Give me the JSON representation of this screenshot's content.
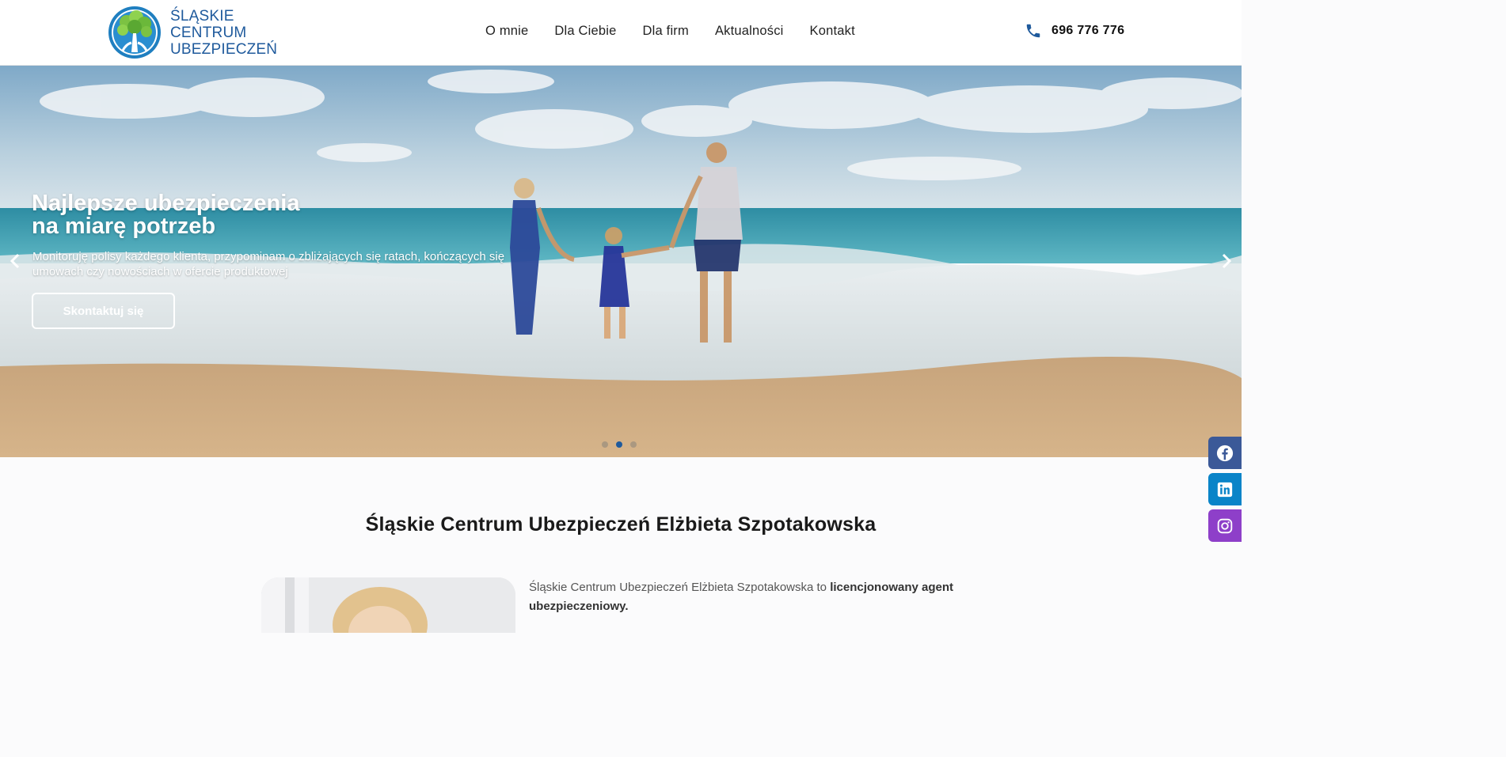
{
  "header": {
    "logo": {
      "line1": "ŚLĄSKIE",
      "line2": "CENTRUM",
      "line3": "UBEZPIECZEŃ"
    },
    "nav": [
      "O mnie",
      "Dla Ciebie",
      "Dla firm",
      "Aktualności",
      "Kontakt"
    ],
    "phone": "696 776 776"
  },
  "hero": {
    "title_line1": "Najlepsze ubezpieczenia",
    "title_line2": "na miarę potrzeb",
    "subtitle": "Monitoruję polisy każdego klienta, przypominam o zbliżających się ratach, kończących się umowach czy nowościach w ofercie produktowej",
    "cta": "Skontaktuj się",
    "slide_count": 3,
    "active_slide": 2
  },
  "social": [
    "facebook-icon",
    "linkedin-icon",
    "instagram-icon"
  ],
  "about": {
    "title": "Śląskie Centrum Ubezpieczeń Elżbieta Szpotakowska",
    "text_plain": "Śląskie Centrum Ubezpieczeń Elżbieta Szpotakowska to ",
    "text_bold": "licencjonowany agent ubezpieczeniowy."
  },
  "colors": {
    "brand": "#1f5a9c",
    "facebook": "#3b5998",
    "linkedin": "#0a84c8",
    "instagram": "#8e3fc9"
  }
}
